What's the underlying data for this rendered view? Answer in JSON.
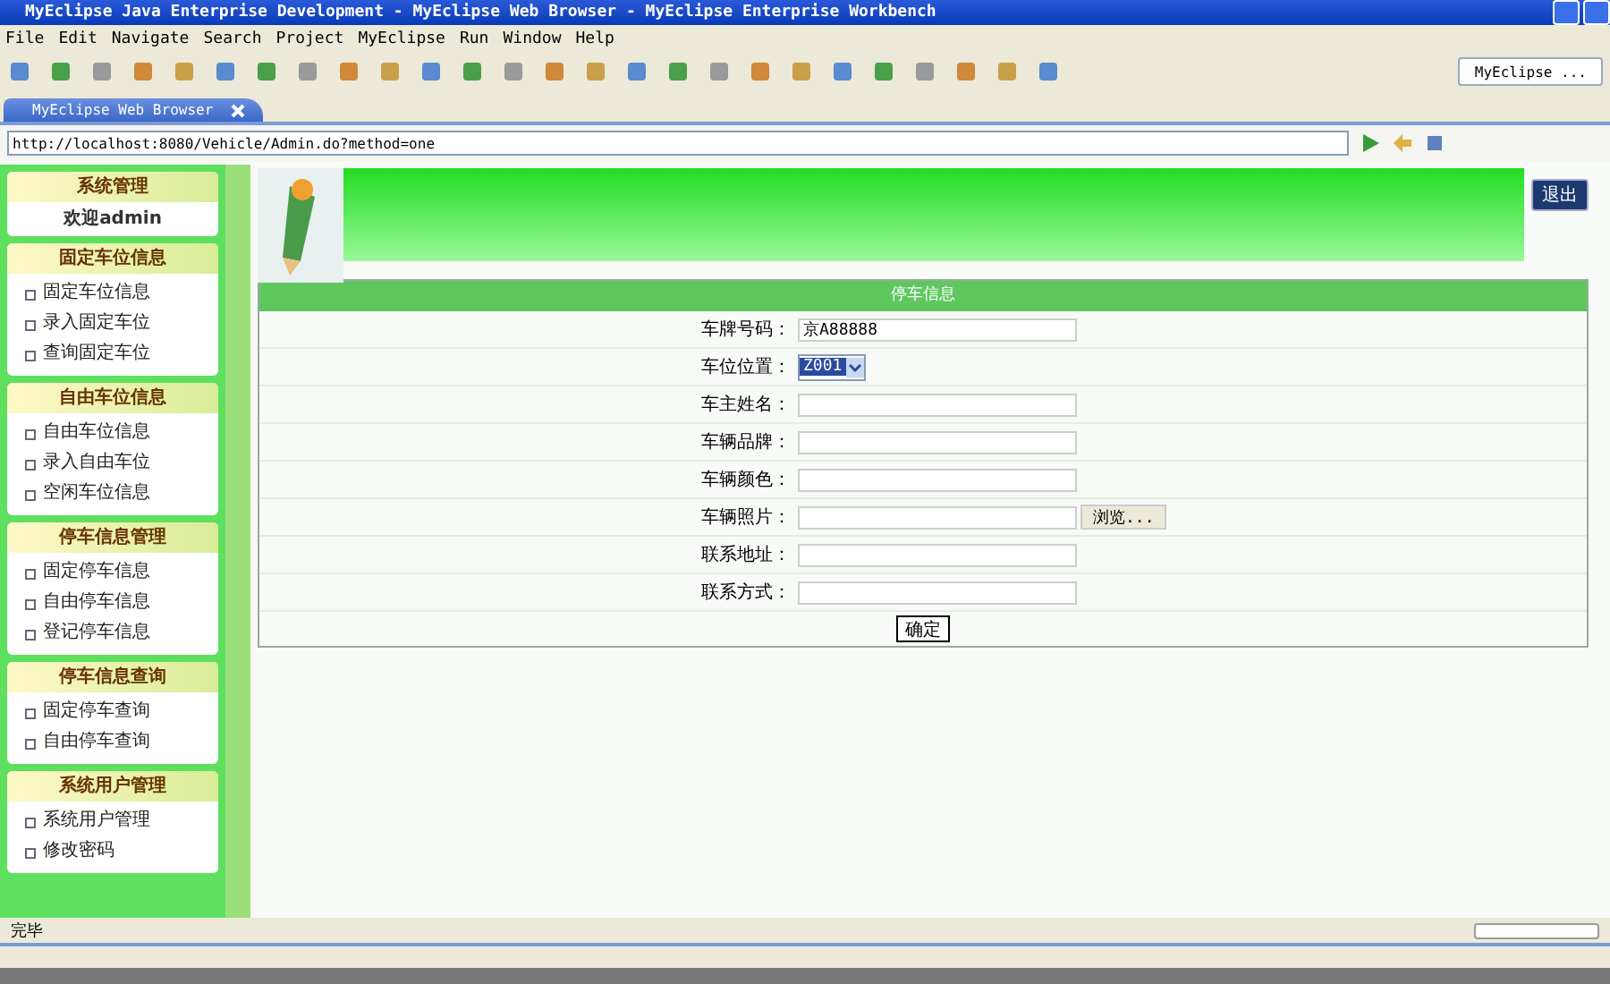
{
  "window": {
    "title": "MyEclipse Java Enterprise Development - MyEclipse Web Browser - MyEclipse Enterprise Workbench"
  },
  "menu": [
    "File",
    "Edit",
    "Navigate",
    "Search",
    "Project",
    "MyEclipse",
    "Run",
    "Window",
    "Help"
  ],
  "perspective": {
    "label": "MyEclipse ..."
  },
  "tab": {
    "label": "MyEclipse Web Browser"
  },
  "address": {
    "value": "http://localhost:8080/Vehicle/Admin.do?method=one"
  },
  "sidebar": [
    {
      "title": "系统管理",
      "items": [
        {
          "label": "欢迎admin",
          "kind": "welcome"
        }
      ]
    },
    {
      "title": "固定车位信息",
      "items": [
        {
          "label": "固定车位信息",
          "kind": "link"
        },
        {
          "label": "录入固定车位",
          "kind": "link"
        },
        {
          "label": "查询固定车位",
          "kind": "link"
        }
      ]
    },
    {
      "title": "自由车位信息",
      "items": [
        {
          "label": "自由车位信息",
          "kind": "link"
        },
        {
          "label": "录入自由车位",
          "kind": "link"
        },
        {
          "label": "空闲车位信息",
          "kind": "link"
        }
      ]
    },
    {
      "title": "停车信息管理",
      "items": [
        {
          "label": "固定停车信息",
          "kind": "link"
        },
        {
          "label": "自由停车信息",
          "kind": "link"
        },
        {
          "label": "登记停车信息",
          "kind": "link"
        }
      ]
    },
    {
      "title": "停车信息查询",
      "items": [
        {
          "label": "固定停车查询",
          "kind": "link"
        },
        {
          "label": "自由停车查询",
          "kind": "link"
        }
      ]
    },
    {
      "title": "系统用户管理",
      "items": [
        {
          "label": "系统用户管理",
          "kind": "link"
        },
        {
          "label": "修改密码",
          "kind": "link"
        }
      ]
    }
  ],
  "logout": "退出",
  "form": {
    "title": "停车信息",
    "fields": [
      {
        "label": "车牌号码：",
        "kind": "text",
        "value": "京A88888"
      },
      {
        "label": "车位位置：",
        "kind": "select",
        "value": "Z001"
      },
      {
        "label": "车主姓名：",
        "kind": "text"
      },
      {
        "label": "车辆品牌：",
        "kind": "text"
      },
      {
        "label": "车辆颜色：",
        "kind": "text"
      },
      {
        "label": "车辆照片：",
        "kind": "file",
        "button": "浏览..."
      },
      {
        "label": "联系地址：",
        "kind": "text"
      },
      {
        "label": "联系方式：",
        "kind": "text"
      }
    ],
    "submit": "确定"
  },
  "status": "完毕",
  "progress": {
    "level": 0
  }
}
